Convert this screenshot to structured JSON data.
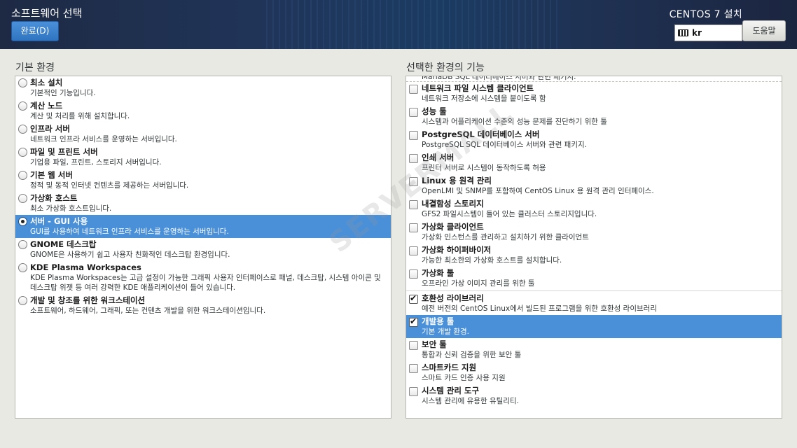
{
  "header": {
    "title": "소프트웨어 선택",
    "done_button": "완료(D)",
    "product": "CENTOS 7 설치",
    "keyboard_layout": "kr",
    "help_button": "도움말"
  },
  "base_environment": {
    "label": "기본 환경",
    "items": [
      {
        "title": "최소 설치",
        "desc": "기본적인 기능입니다.",
        "selected": false
      },
      {
        "title": "계산 노드",
        "desc": "계산 및 처리를 위해 설치합니다.",
        "selected": false
      },
      {
        "title": "인프라 서버",
        "desc": "네트워크 인프라 서비스를 운영하는 서버입니다.",
        "selected": false
      },
      {
        "title": "파일 및 프린트 서버",
        "desc": "기업용 파일, 프린트, 스토리지 서버입니다.",
        "selected": false
      },
      {
        "title": "기본 웹 서버",
        "desc": "정적 및 동적 인터넷 컨텐츠를 제공하는 서버입니다.",
        "selected": false
      },
      {
        "title": "가상화 호스트",
        "desc": "최소 가상화 호스트입니다.",
        "selected": false
      },
      {
        "title": "서버 - GUI 사용",
        "desc": "GUI를 사용하여 네트워크 인프라 서비스를 운영하는 서버입니다.",
        "selected": true
      },
      {
        "title": "GNOME 데스크탑",
        "desc": "GNOME은 사용하기 쉽고 사용자 친화적인 데스크탑 환경입니다.",
        "selected": false
      },
      {
        "title": "KDE Plasma Workspaces",
        "desc": "KDE Plasma Workspaces는 고급 설정이 가능한 그래픽 사용자 인터페이스로 패널, 데스크탑, 시스템 아이콘 및 데스크탑 위젯 등 여러 강력한 KDE 애플리케이션이 들어 있습니다.",
        "selected": false
      },
      {
        "title": "개발 및 창조를 위한 워크스테이션",
        "desc": "소프트웨어, 하드웨어, 그래픽, 또는 컨텐츠 개발을 위한 워크스테이션입니다.",
        "selected": false
      }
    ]
  },
  "addons": {
    "label": "선택한 환경의 기능",
    "truncated_text": "MariaDB SQL 데이터베이스 서버와 관련 패키지.",
    "items": [
      {
        "title": "네트워크 파일 시스템 클라이언트",
        "desc": "네트워크 저장소에 시스템을 붙이도록 함",
        "checked": false,
        "selected": false
      },
      {
        "title": "성능 툴",
        "desc": "시스템과 어플리케이션 수준의 성능 문제를 진단하기 위한 툴",
        "checked": false,
        "selected": false
      },
      {
        "title": "PostgreSQL 데이터베이스 서버",
        "desc": "PostgreSQL SQL 데이터베이스 서버와 관련 패키지.",
        "checked": false,
        "selected": false
      },
      {
        "title": "인쇄 서버",
        "desc": "프린터 서버로 시스템이 동작하도록 허용",
        "checked": false,
        "selected": false
      },
      {
        "title": "Linux 용 원격 관리",
        "desc": "OpenLMI 및 SNMP를 포함하여 CentOS Linux 용 원격 관리 인터페이스.",
        "checked": false,
        "selected": false
      },
      {
        "title": "내결함성 스토리지",
        "desc": "GFS2 파일시스템이 들어 있는 클러스터 스토리지입니다.",
        "checked": false,
        "selected": false
      },
      {
        "title": "가상화 클라이언트",
        "desc": "가상화 인스턴스를 관리하고 설치하기 위한 클라이언트",
        "checked": false,
        "selected": false
      },
      {
        "title": "가상화 하이퍼바이저",
        "desc": "가능한 최소한의 가상화 호스트를 설치합니다.",
        "checked": false,
        "selected": false
      },
      {
        "title": "가상화 툴",
        "desc": "오프라인 가상 이미지 관리를 위한 툴",
        "checked": false,
        "selected": false
      },
      {
        "title": "호환성 라이브러리",
        "desc": "예전 버전의 CentOS Linux에서 빌드된 프로그램을 위한 호환성 라이브러리",
        "checked": true,
        "selected": false
      },
      {
        "title": "개발용 툴",
        "desc": "기본 개발 환경.",
        "checked": true,
        "selected": true
      },
      {
        "title": "보안 툴",
        "desc": "통합과 신뢰 검증을 위한 보안 툴",
        "checked": false,
        "selected": false
      },
      {
        "title": "스마트카드 지원",
        "desc": "스마트 카드 인증 사용 지원",
        "checked": false,
        "selected": false
      },
      {
        "title": "시스템 관리 도구",
        "desc": "시스템 관리에 유용한 유틸리티.",
        "checked": false,
        "selected": false
      }
    ]
  },
  "watermark": "SERVERMALL",
  "colors": {
    "accent": "#4a90d9",
    "header": "#1f3152",
    "background": "#e9e9e4"
  }
}
